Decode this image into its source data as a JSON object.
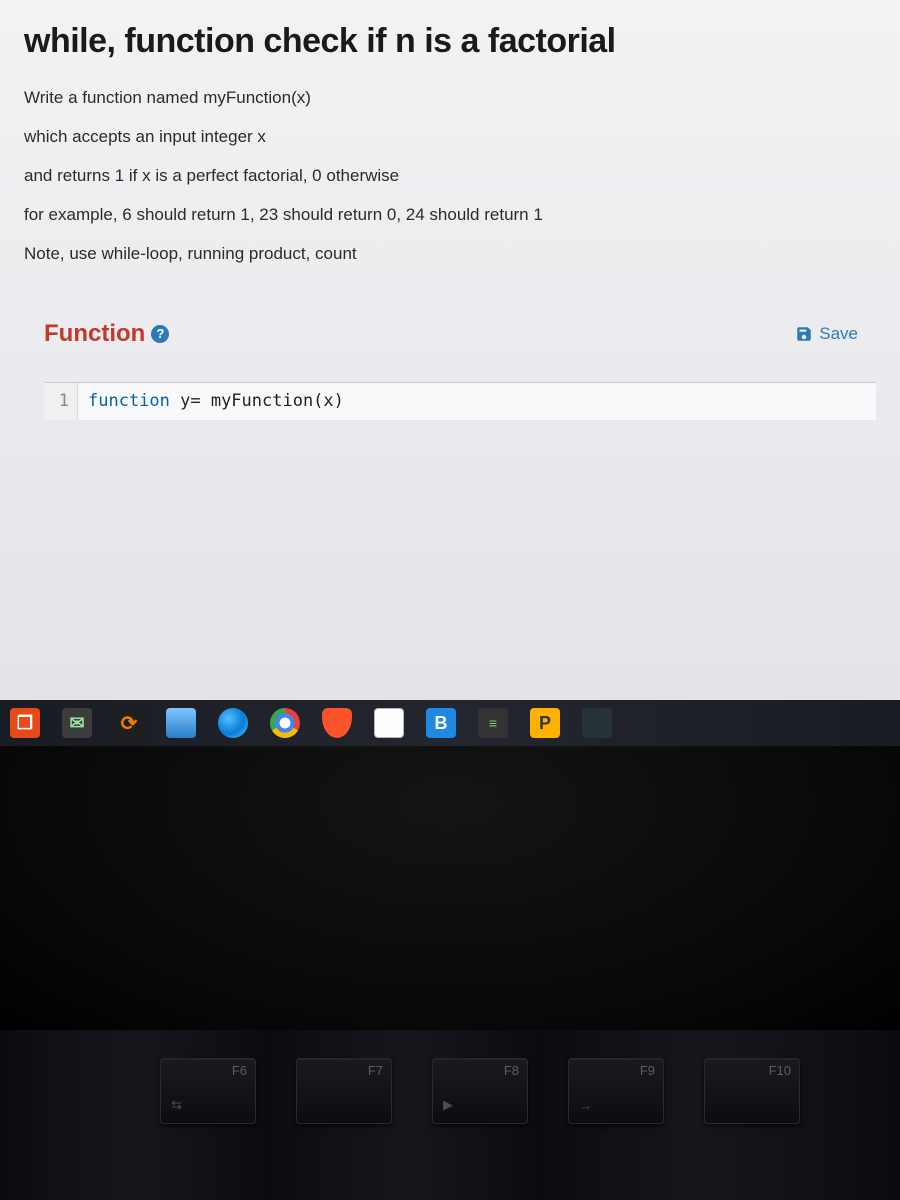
{
  "page": {
    "title": "while, function check if n is a factorial",
    "description": [
      "Write a function named myFunction(x)",
      "which accepts an input integer x",
      "and returns 1 if x is a perfect factorial, 0 otherwise",
      "for example, 6 should return 1, 23 should return 0, 24 should return 1",
      "Note, use while-loop, running product, count"
    ]
  },
  "section": {
    "label": "Function",
    "help_symbol": "?",
    "save_label": "Save"
  },
  "editor": {
    "line_number": "1",
    "keyword": "function",
    "rest": " y= myFunction(x)"
  },
  "taskbar": {
    "items": [
      {
        "name": "office-icon",
        "glyph": "❐"
      },
      {
        "name": "wechat-icon",
        "glyph": "✉"
      },
      {
        "name": "reload-icon",
        "glyph": "⟳"
      },
      {
        "name": "file-explorer-icon",
        "glyph": ""
      },
      {
        "name": "edge-icon",
        "glyph": ""
      },
      {
        "name": "chrome-icon",
        "glyph": ""
      },
      {
        "name": "brave-icon",
        "glyph": ""
      },
      {
        "name": "document-icon",
        "glyph": ""
      },
      {
        "name": "app-b-icon",
        "glyph": "B"
      },
      {
        "name": "calculator-icon",
        "glyph": "≡"
      },
      {
        "name": "app-p-icon",
        "glyph": "P"
      },
      {
        "name": "screens-icon",
        "glyph": ""
      }
    ]
  },
  "keyboard": {
    "keys": [
      {
        "label": "F6",
        "sym": "⇆"
      },
      {
        "label": "F7",
        "sym": ""
      },
      {
        "label": "F8",
        "sym": "▶"
      },
      {
        "label": "F9",
        "sym": "→"
      },
      {
        "label": "F10",
        "sym": ""
      }
    ]
  }
}
